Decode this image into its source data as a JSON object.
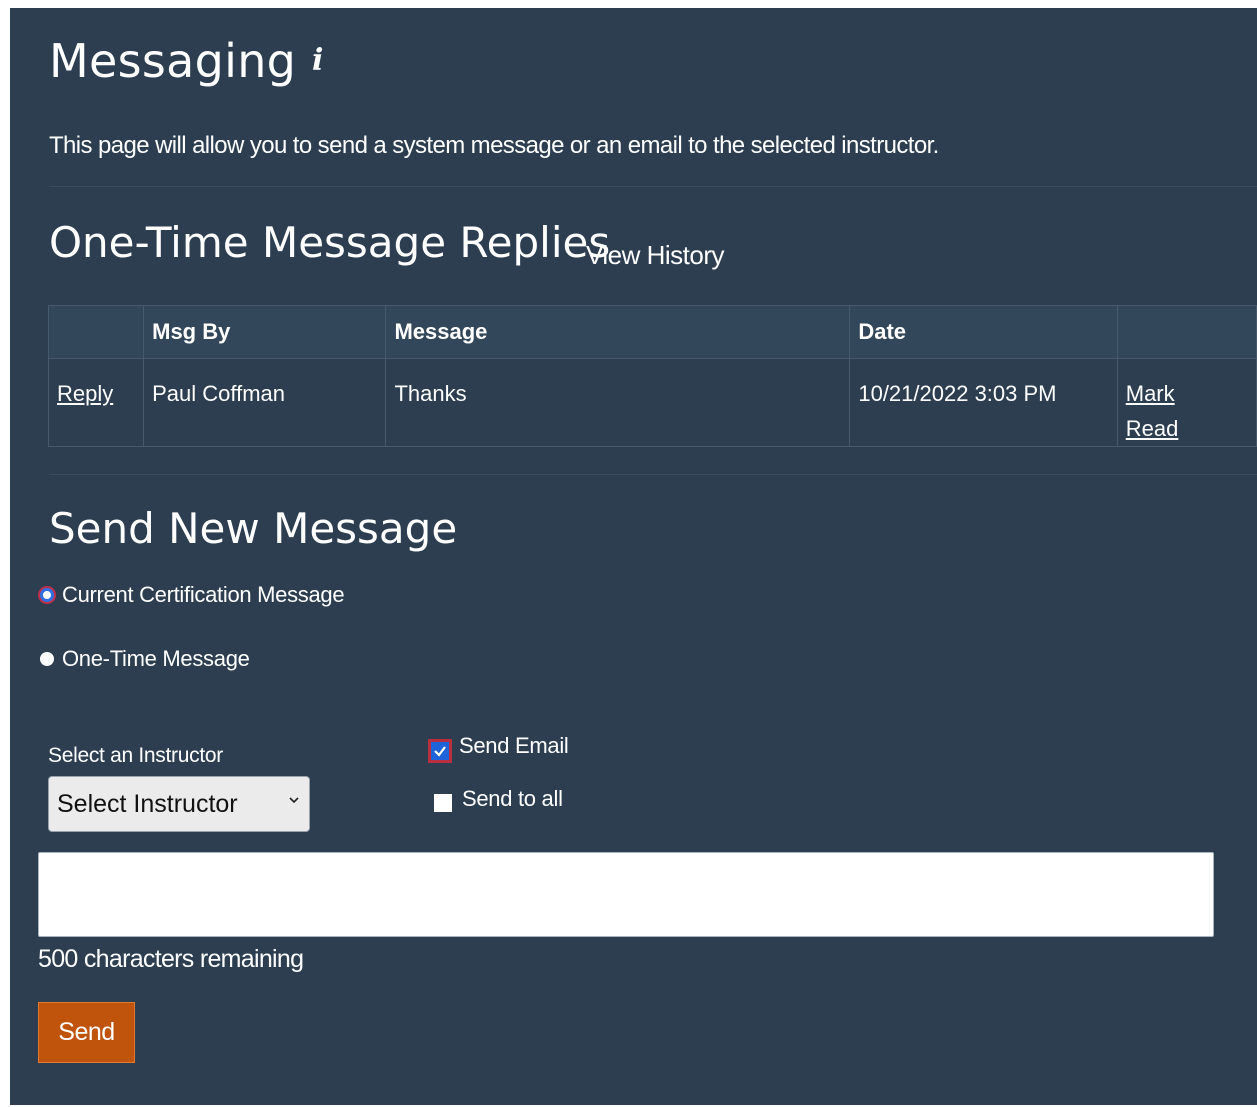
{
  "page": {
    "title": "Messaging",
    "intro": "This page will allow you to send a system message or an email to the selected instructor."
  },
  "replies": {
    "title": "One-Time Message Replies",
    "view_history": "View History",
    "columns": [
      "",
      "Msg By",
      "Message",
      "Date",
      ""
    ],
    "rows": [
      {
        "reply": "Reply",
        "msg_by": "Paul Coffman",
        "message": "Thanks",
        "date": "10/21/2022 3:03 PM",
        "mark_read_1": "Mark",
        "mark_read_2": "Read"
      }
    ]
  },
  "send": {
    "title": "Send New Message",
    "radio_current": "Current Certification Message",
    "radio_one_time": "One-Time Message",
    "radio_selected": "current",
    "instructor_label": "Select an Instructor",
    "instructor_select": "Select Instructor",
    "send_email": "Send Email",
    "send_email_checked": true,
    "send_to_all": "Send to all",
    "send_to_all_checked": false,
    "message_value": "",
    "remaining": "500 characters remaining",
    "send_button": "Send"
  },
  "colors": {
    "panel_bg": "#2c3e50",
    "button_bg": "#c0540c",
    "check_accent": "#1e63d9"
  },
  "icons": {
    "info": "info-icon",
    "select_chevron": "chevron-down-icon",
    "check": "check-icon"
  }
}
